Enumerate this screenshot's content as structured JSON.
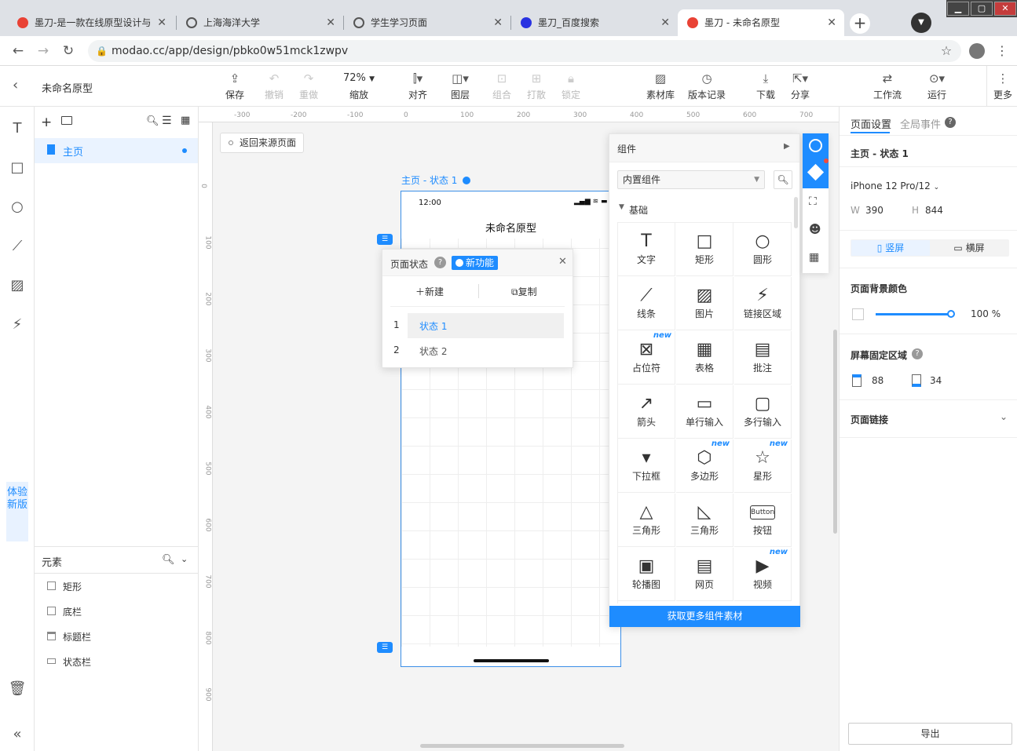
{
  "browser": {
    "tabs": [
      {
        "title": "墨刀-是一款在线原型设计与",
        "fav_color": "#e94235"
      },
      {
        "title": "上海海洋大学",
        "fav_color": "#555555"
      },
      {
        "title": "学生学习页面",
        "fav_color": "#555555"
      },
      {
        "title": "墨刀_百度搜索",
        "fav_color": "#2932e1"
      },
      {
        "title": "墨刀 - 未命名原型",
        "fav_color": "#e94235"
      }
    ],
    "url": "modao.cc/app/design/pbko0w51mck1zwpv"
  },
  "app": {
    "project_title": "未命名原型",
    "toolbar": {
      "save": "保存",
      "undo": "撤销",
      "redo": "重做",
      "zoom_value": "72%",
      "zoom_label": "缩放",
      "align": "对齐",
      "layer": "图层",
      "group": "组合",
      "ungroup": "打散",
      "lock": "锁定",
      "assets": "素材库",
      "history": "版本记录",
      "download": "下载",
      "share": "分享",
      "workflow": "工作流",
      "run": "运行",
      "more": "更多"
    },
    "try_new": "体验新版",
    "pages": {
      "items": [
        {
          "label": "主页"
        }
      ]
    },
    "elements": {
      "title": "元素",
      "items": [
        {
          "label": "矩形"
        },
        {
          "label": "底栏"
        },
        {
          "label": "标题栏"
        },
        {
          "label": "状态栏"
        }
      ]
    },
    "canvas": {
      "back_button": "返回来源页面",
      "ruler_h": [
        "-300",
        "-200",
        "-100",
        "0",
        "100",
        "200",
        "300",
        "400",
        "500",
        "600",
        "700"
      ],
      "ruler_v": [
        "0",
        "100",
        "200",
        "300",
        "400",
        "500",
        "600",
        "700",
        "800",
        "900"
      ],
      "frame_label": "主页 - 状态 1",
      "status_time": "12:00",
      "phone_title": "未命名原型"
    },
    "state_popup": {
      "title": "页面状态",
      "badge": "新功能",
      "new_btn": "新建",
      "copy_btn": "复制",
      "states": [
        {
          "num": "1",
          "label": "状态 1"
        },
        {
          "num": "2",
          "label": "状态 2"
        }
      ]
    },
    "component_panel": {
      "title": "组件",
      "library": "内置组件",
      "section": "基础",
      "items": [
        {
          "label": "文字",
          "glyph": "T",
          "new": ""
        },
        {
          "label": "矩形",
          "glyph": "□",
          "new": ""
        },
        {
          "label": "圆形",
          "glyph": "○",
          "new": ""
        },
        {
          "label": "线条",
          "glyph": "⟋",
          "new": ""
        },
        {
          "label": "图片",
          "glyph": "▨",
          "new": ""
        },
        {
          "label": "链接区域",
          "glyph": "⚡",
          "new": ""
        },
        {
          "label": "占位符",
          "glyph": "⊠",
          "new": "new"
        },
        {
          "label": "表格",
          "glyph": "▦",
          "new": ""
        },
        {
          "label": "批注",
          "glyph": "▤",
          "new": ""
        },
        {
          "label": "箭头",
          "glyph": "↗",
          "new": ""
        },
        {
          "label": "单行输入",
          "glyph": "▭",
          "new": ""
        },
        {
          "label": "多行输入",
          "glyph": "▢",
          "new": ""
        },
        {
          "label": "下拉框",
          "glyph": "▾",
          "new": ""
        },
        {
          "label": "多边形",
          "glyph": "⬡",
          "new": "new"
        },
        {
          "label": "星形",
          "glyph": "☆",
          "new": "new"
        },
        {
          "label": "三角形",
          "glyph": "△",
          "new": ""
        },
        {
          "label": "三角形",
          "glyph": "◺",
          "new": ""
        },
        {
          "label": "按钮",
          "glyph": "Button",
          "new": ""
        },
        {
          "label": "轮播图",
          "glyph": "▣",
          "new": ""
        },
        {
          "label": "网页",
          "glyph": "▤",
          "new": ""
        },
        {
          "label": "视频",
          "glyph": "▶",
          "new": "new"
        }
      ],
      "footer": "获取更多组件素材"
    },
    "right_panel": {
      "tab_page": "页面设置",
      "tab_global": "全局事件",
      "page_state": "主页 - 状态 1",
      "device": "iPhone 12 Pro/12",
      "w_label": "W",
      "w_value": "390",
      "h_label": "H",
      "h_value": "844",
      "portrait": "竖屏",
      "landscape": "横屏",
      "bg_title": "页面背景颜色",
      "opacity": "100",
      "fixed_title": "屏幕固定区域",
      "fixed_top": "88",
      "fixed_bottom": "34",
      "link_title": "页面链接",
      "export": "导出"
    },
    "colors": {
      "accent": "#1e8cff"
    }
  }
}
